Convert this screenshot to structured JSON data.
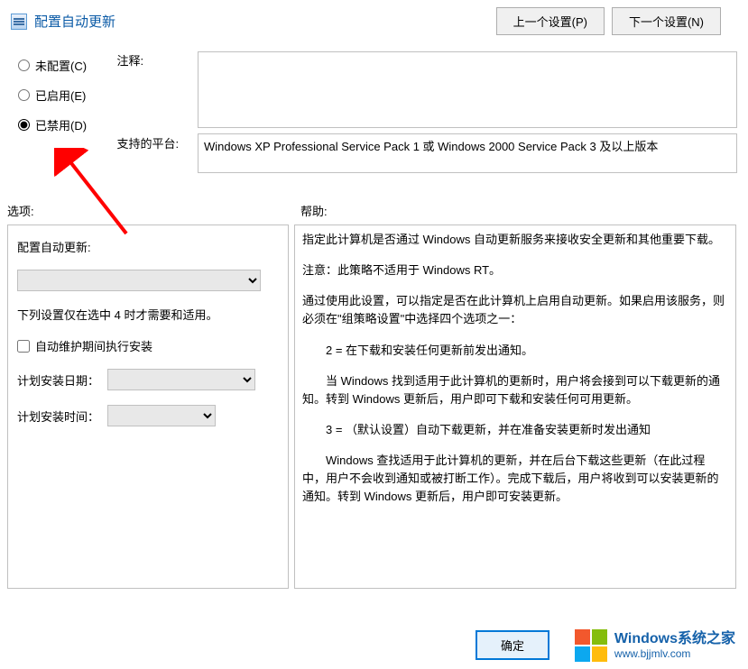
{
  "header": {
    "title": "配置自动更新",
    "prev_button": "上一个设置(P)",
    "next_button": "下一个设置(N)"
  },
  "radios": {
    "not_configured": "未配置(C)",
    "enabled": "已启用(E)",
    "disabled": "已禁用(D)"
  },
  "labels": {
    "comment": "注释:",
    "platform": "支持的平台:",
    "options": "选项:",
    "help": "帮助:"
  },
  "platform_text": "Windows XP Professional Service Pack 1 或 Windows 2000 Service Pack 3 及以上版本",
  "options": {
    "config_label": "配置自动更新:",
    "note": "下列设置仅在选中 4 时才需要和适用。",
    "maintenance_checkbox": "自动维护期间执行安装",
    "schedule_day_label": "计划安装日期：",
    "schedule_time_label": "计划安装时间："
  },
  "help": {
    "p1": "指定此计算机是否通过 Windows 自动更新服务来接收安全更新和其他重要下载。",
    "p2": "注意：此策略不适用于 Windows RT。",
    "p3": "通过使用此设置，可以指定是否在此计算机上启用自动更新。如果启用该服务，则必须在\"组策略设置\"中选择四个选项之一：",
    "p4": "2 = 在下载和安装任何更新前发出通知。",
    "p5": "当 Windows 找到适用于此计算机的更新时，用户将会接到可以下载更新的通知。转到 Windows 更新后，用户即可下载和安装任何可用更新。",
    "p6": "3 = （默认设置）自动下载更新，并在准备安装更新时发出通知",
    "p7": "Windows 查找适用于此计算机的更新，并在后台下载这些更新（在此过程中，用户不会收到通知或被打断工作）。完成下载后，用户将收到可以安装更新的通知。转到 Windows 更新后，用户即可安装更新。"
  },
  "buttons": {
    "ok": "确定"
  },
  "watermark": {
    "line1": "Windows系统之家",
    "line2": "www.bjjmlv.com"
  }
}
